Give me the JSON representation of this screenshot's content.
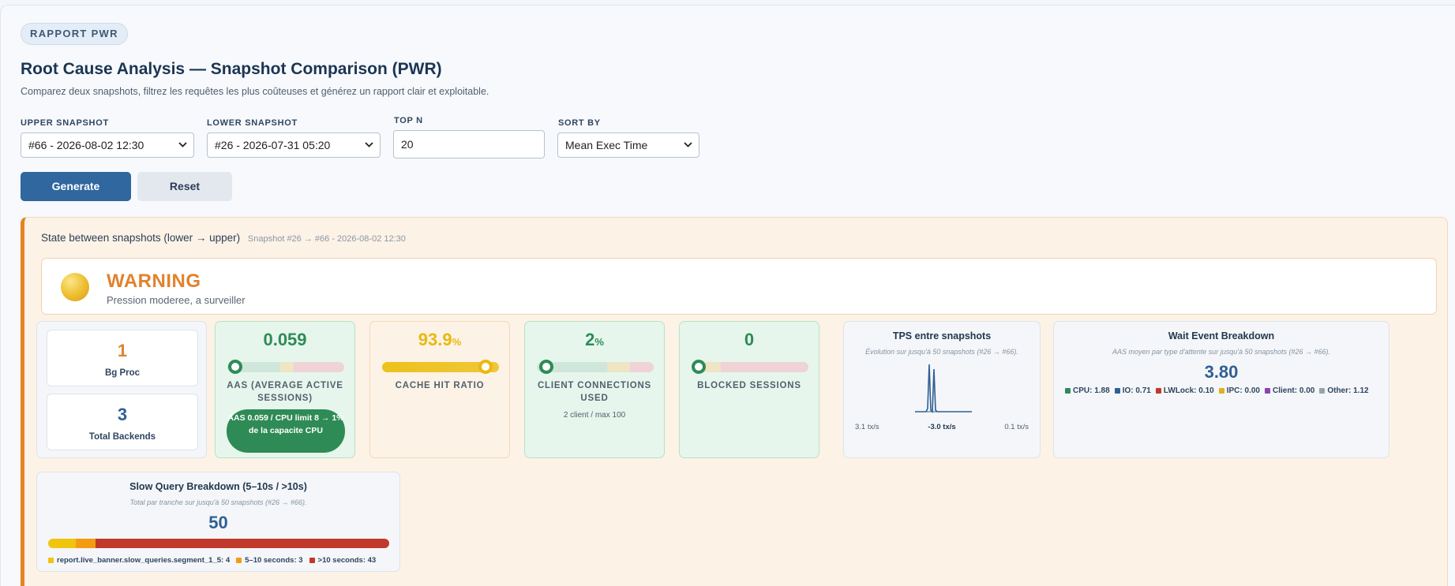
{
  "header": {
    "badge": "RAPPORT PWR",
    "title": "Root Cause Analysis — Snapshot Comparison (PWR)",
    "subtitle": "Comparez deux snapshots, filtrez les requêtes les plus coûteuses et générez un rapport clair et exploitable."
  },
  "form": {
    "upper_label": "UPPER SNAPSHOT",
    "upper_value": "#66 - 2026-08-02 12:30",
    "lower_label": "LOWER SNAPSHOT",
    "lower_value": "#26 - 2026-07-31 05:20",
    "topn_label": "TOP N",
    "topn_value": "20",
    "sort_label": "SORT BY",
    "sort_value": "Mean Exec Time",
    "generate_label": "Generate",
    "reset_label": "Reset"
  },
  "state": {
    "heading": "State between snapshots (lower → upper)",
    "meta": "Snapshot #26 → #66 - 2026-08-02 12:30",
    "status_title": "WARNING",
    "status_sub": "Pression moderee, a surveiller"
  },
  "counters": {
    "bg_proc_value": "1",
    "bg_proc_label": "Bg Proc",
    "backends_value": "3",
    "backends_label": "Total Backends"
  },
  "gauges": {
    "aas": {
      "value": "0.059",
      "label": "AAS (AVERAGE ACTIVE SESSIONS)",
      "badge": "AAS 0.059 / CPU limit 8 → 1% de la capacite CPU",
      "level": 0.01
    },
    "cache": {
      "value": "93.9",
      "unit": "%",
      "label": "CACHE HIT RATIO",
      "level": 0.939
    },
    "client": {
      "value": "2",
      "unit": "%",
      "label": "CLIENT CONNECTIONS USED",
      "note": "2 client / max 100",
      "level": 0.02
    },
    "blocked": {
      "value": "0",
      "label": "BLOCKED SESSIONS",
      "level": 0
    }
  },
  "tps": {
    "title": "TPS entre snapshots",
    "subtitle": "Évolution sur jusqu'à 50 snapshots (#26 → #66).",
    "left_value": "3.1 tx/s",
    "center_value": "-3.0 tx/s",
    "right_value": "0.1 tx/s"
  },
  "wait": {
    "title": "Wait Event Breakdown",
    "subtitle": "AAS moyen par type d'attente sur jusqu'à 50 snapshots (#26 → #66).",
    "total": "3.80",
    "items": [
      {
        "label": "CPU: 1.88",
        "color": "#2e8b57"
      },
      {
        "label": "IO: 0.71",
        "color": "#2f5f93"
      },
      {
        "label": "LWLock: 0.10",
        "color": "#c0392b"
      },
      {
        "label": "IPC: 0.00",
        "color": "#e0b020"
      },
      {
        "label": "Client: 0.00",
        "color": "#8e44ad"
      },
      {
        "label": "Other: 1.12",
        "color": "#95a5a6"
      }
    ]
  },
  "slow": {
    "title": "Slow Query Breakdown (5–10s / >10s)",
    "subtitle": "Total par tranche sur jusqu'à 50 snapshots (#26 → #66).",
    "total": "50",
    "segments": [
      {
        "label": "report.live_banner.slow_queries.segment_1_5: 4",
        "value": 4,
        "color": "#f1c40f"
      },
      {
        "label": "5–10 seconds: 3",
        "value": 3,
        "color": "#f39c12"
      },
      {
        "label": ">10 seconds: 43",
        "value": 43,
        "color": "#c0392b"
      }
    ]
  }
}
